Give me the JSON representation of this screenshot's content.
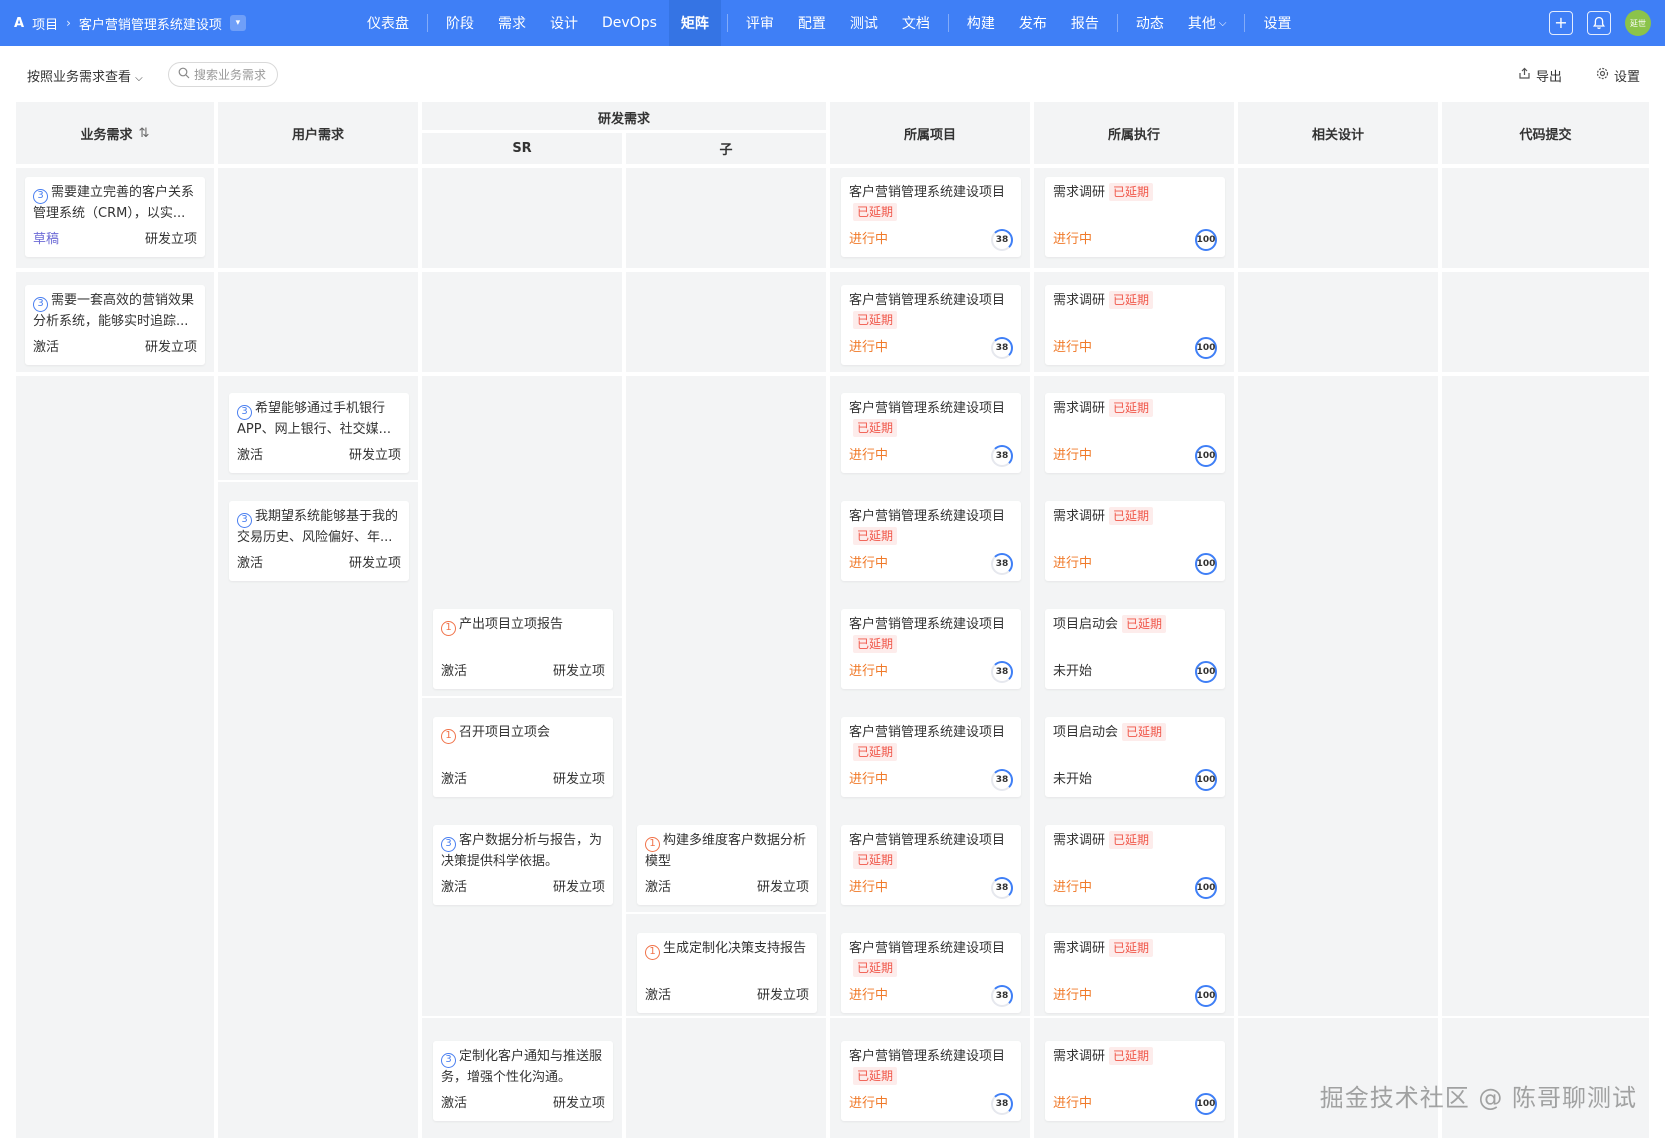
{
  "nav": {
    "project_label": "项目",
    "project_name": "客户营销管理系统建设项",
    "menu": [
      "仪表盘",
      "阶段",
      "需求",
      "设计",
      "DevOps",
      "矩阵",
      "评审",
      "配置",
      "测试",
      "文档",
      "构建",
      "发布",
      "报告",
      "动态",
      "其他",
      "设置"
    ],
    "active": "矩阵",
    "avatar_text": "延世"
  },
  "toolbar": {
    "view_label": "按照业务需求查看",
    "search_placeholder": "搜索业务需求",
    "export_label": "导出",
    "settings_label": "设置"
  },
  "columns": {
    "business": "业务需求",
    "user": "用户需求",
    "dev": "研发需求",
    "sr": "SR",
    "sub": "子",
    "project": "所属项目",
    "exec": "所属执行",
    "design": "相关设计",
    "code": "代码提交"
  },
  "business_cards": [
    {
      "num": "3",
      "title": "需要建立完善的客户关系管理系统（CRM），以实...",
      "status": "草稿",
      "stage": "研发立项"
    },
    {
      "num": "3",
      "title": "需要一套高效的营销效果分析系统，能够实时追踪...",
      "status": "激活",
      "stage": "研发立项"
    }
  ],
  "user_cards": [
    {
      "num": "3",
      "title": "希望能够通过手机银行APP、网上银行、社交媒...",
      "status": "激活",
      "stage": "研发立项"
    },
    {
      "num": "3",
      "title": "我期望系统能够基于我的交易历史、风险偏好、年...",
      "status": "激活",
      "stage": "研发立项"
    }
  ],
  "sr_cards": [
    {
      "num": "1",
      "title": "产出项目立项报告",
      "status": "激活",
      "stage": "研发立项"
    },
    {
      "num": "1",
      "title": "召开项目立项会",
      "status": "激活",
      "stage": "研发立项"
    },
    {
      "num": "3",
      "title": "客户数据分析与报告，为决策提供科学依据。",
      "status": "激活",
      "stage": "研发立项"
    },
    {
      "num": "3",
      "title": "定制化客户通知与推送服务，增强个性化沟通。",
      "status": "激活",
      "stage": "研发立项"
    }
  ],
  "sub_cards": [
    {
      "num": "1",
      "title": "构建多维度客户数据分析模型",
      "status": "激活",
      "stage": "研发立项"
    },
    {
      "num": "1",
      "title": "生成定制化决策支持报告",
      "status": "激活",
      "stage": "研发立项"
    }
  ],
  "project_card": {
    "title": "客户营销管理系统建设项目",
    "tag": "已延期",
    "state": "进行中",
    "progress": "38"
  },
  "exec_cards": [
    {
      "title": "需求调研",
      "tag": "已延期",
      "state": "进行中",
      "progress": "100"
    },
    {
      "title": "需求调研",
      "tag": "已延期",
      "state": "进行中",
      "progress": "100"
    },
    {
      "title": "需求调研",
      "tag": "已延期",
      "state": "进行中",
      "progress": "100"
    },
    {
      "title": "需求调研",
      "tag": "已延期",
      "state": "进行中",
      "progress": "100"
    },
    {
      "title": "项目启动会",
      "tag": "已延期",
      "state": "未开始",
      "progress": "100"
    },
    {
      "title": "项目启动会",
      "tag": "已延期",
      "state": "未开始",
      "progress": "100"
    },
    {
      "title": "需求调研",
      "tag": "已延期",
      "state": "进行中",
      "progress": "100"
    },
    {
      "title": "需求调研",
      "tag": "已延期",
      "state": "进行中",
      "progress": "100"
    },
    {
      "title": "需求调研",
      "tag": "已延期",
      "state": "进行中",
      "progress": "100"
    }
  ],
  "watermark": "掘金技术社区 @ 陈哥聊测试"
}
